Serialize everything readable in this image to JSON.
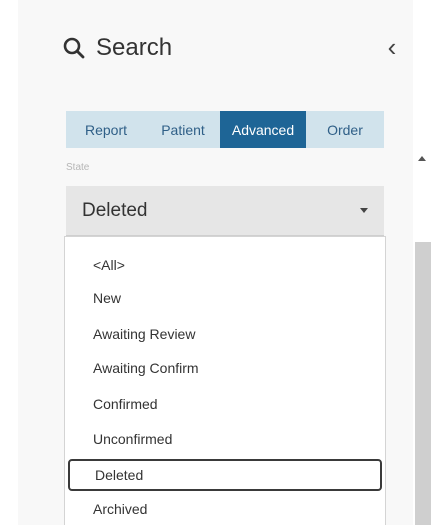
{
  "header": {
    "title": "Search",
    "collapse_label": "‹"
  },
  "tabs": [
    {
      "label": "Report",
      "active": false
    },
    {
      "label": "Patient",
      "active": false
    },
    {
      "label": "Advanced",
      "active": true
    },
    {
      "label": "Order",
      "active": false
    }
  ],
  "state_field": {
    "label": "State",
    "selected_value": "Deleted",
    "options": [
      "<All>",
      "New",
      "Awaiting Review",
      "Awaiting Confirm",
      "Confirmed",
      "Unconfirmed",
      "Deleted",
      "Archived"
    ]
  },
  "colors": {
    "tab_bar": "#d1e3ec",
    "tab_active": "#1e6596",
    "tab_text": "#2f5f87",
    "select_bg": "#e6e6e6"
  }
}
